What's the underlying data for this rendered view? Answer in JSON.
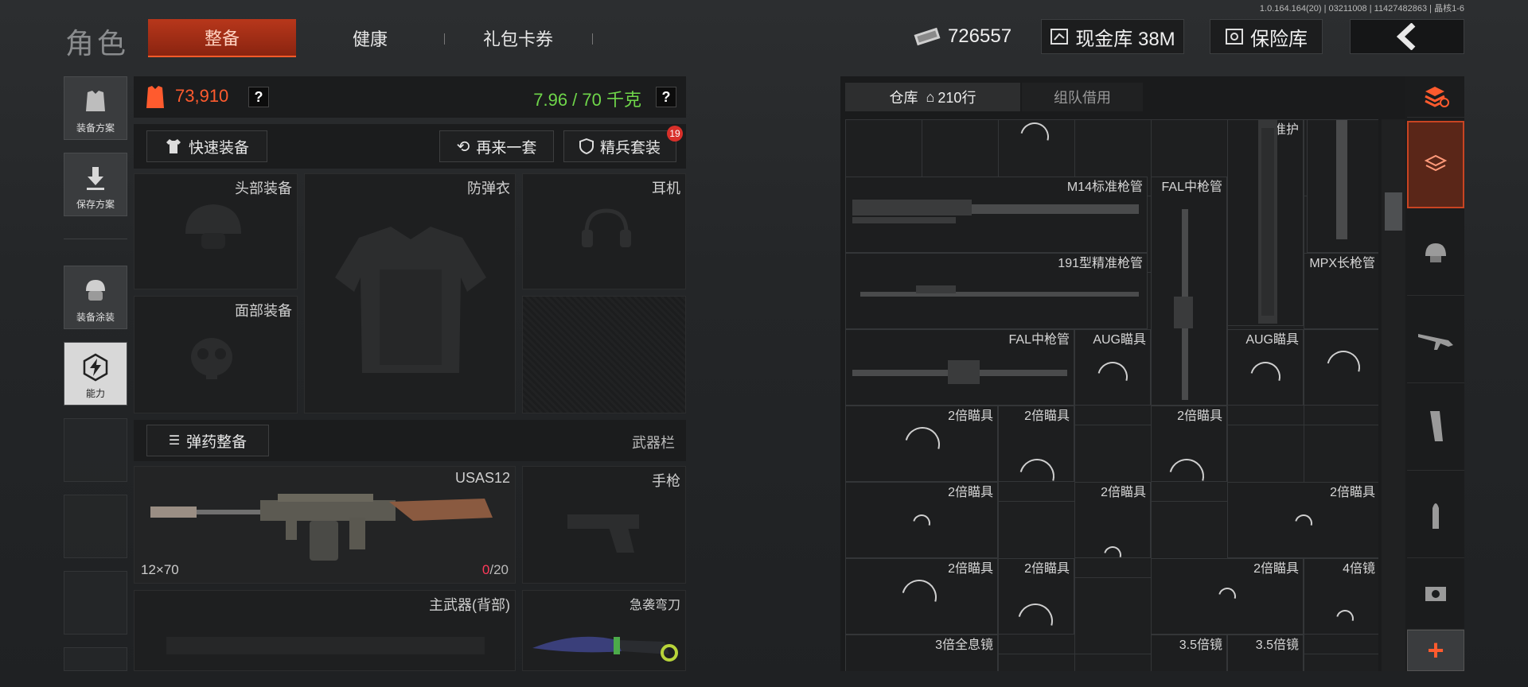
{
  "version": "1.0.164.164(20) | 03211008 | 11427482863 | 晶核1-6",
  "header": {
    "title": "角色",
    "tabs": [
      "整备",
      "健康",
      "礼包卡券"
    ],
    "money": "726557",
    "cash_vault": "现金库 38M",
    "insurance": "保险库"
  },
  "side": {
    "plans": "装备方案",
    "save": "保存方案",
    "paint": "装备涂装",
    "ability": "能力"
  },
  "loadout": {
    "value": "73,910",
    "weight": "7.96 / 70 千克",
    "quick_equip": "快速装备",
    "again": "再来一套",
    "elite": "精兵套装",
    "elite_badge": "19",
    "slots": {
      "head": "头部装备",
      "armor": "防弹衣",
      "ears": "耳机",
      "face": "面部装备"
    },
    "ammo": "弹药整备",
    "weapon_bar": "武器栏",
    "weapon_name": "USAS12",
    "caliber": "12×70",
    "ammo_now": "0",
    "ammo_max": "/20",
    "pistol": "手枪",
    "primary_back": "主武器(背部)",
    "knife": "急袭弯刀"
  },
  "warehouse": {
    "tab_store": "仓库",
    "rows": "210行",
    "tab_team": "组队借用",
    "items": {
      "m14": "M14标准枪管",
      "fal1": "FAL中枪管",
      "std": "标准护",
      "b191": "191型精准枪管",
      "mpx": "MPX长枪管",
      "fal2": "FAL中枪管",
      "aug1": "AUG瞄具",
      "aug2": "AUG瞄具",
      "x2": "2倍瞄具",
      "x4": "4倍镜",
      "holo3": "3倍全息镜",
      "x35": "3.5倍镜"
    }
  }
}
